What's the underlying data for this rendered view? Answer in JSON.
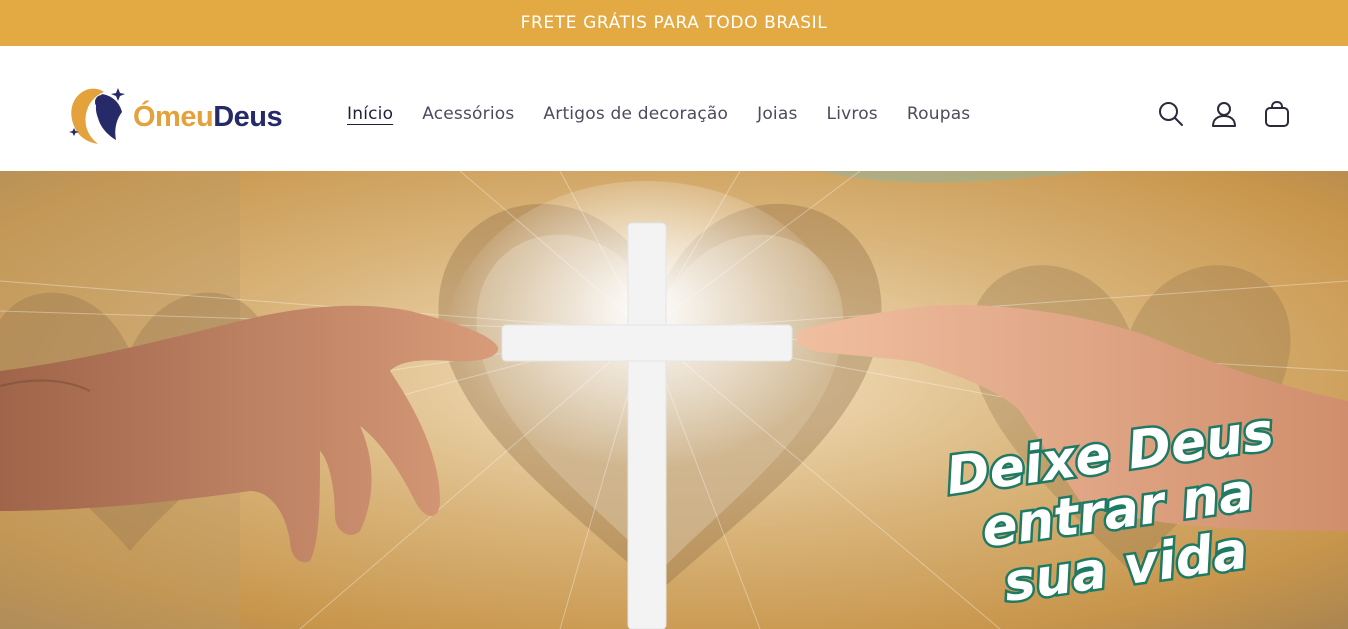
{
  "announcement": {
    "text": "FRETE GRÁTIS PARA TODO BRASIL"
  },
  "brand": {
    "part1": "Ómeu",
    "part2": "Deus",
    "accent": "#e3a23c",
    "dark": "#262a68"
  },
  "nav": {
    "items": [
      {
        "label": "Início",
        "active": true
      },
      {
        "label": "Acessórios"
      },
      {
        "label": "Artigos de decoração"
      },
      {
        "label": "Joias"
      },
      {
        "label": "Livros"
      },
      {
        "label": "Roupas"
      }
    ]
  },
  "header_icons": [
    "search-icon",
    "account-icon",
    "cart-icon"
  ],
  "hero": {
    "tagline": [
      "Deixe Deus",
      "entrar na",
      "sua vida"
    ],
    "colors": {
      "text": "#ffffff",
      "outline": "#1f7a63",
      "banner": "#e3aa44"
    }
  }
}
